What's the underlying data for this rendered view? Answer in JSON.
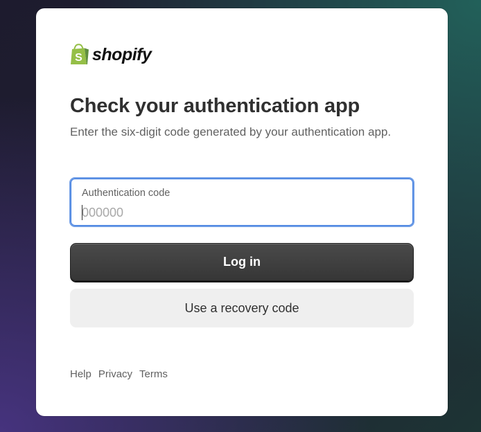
{
  "brand": {
    "name": "shopify",
    "icon": "shopify-bag-icon",
    "color": "#95bf47"
  },
  "page": {
    "title": "Check your authentication app",
    "subtitle": "Enter the six-digit code generated by your authentication app."
  },
  "auth_field": {
    "label": "Authentication code",
    "placeholder": "000000",
    "value": ""
  },
  "actions": {
    "login_label": "Log in",
    "recovery_label": "Use a recovery code"
  },
  "footer": {
    "links": [
      "Help",
      "Privacy",
      "Terms"
    ]
  },
  "colors": {
    "primary_button": "#363636",
    "focus_ring": "#3c7be0"
  }
}
